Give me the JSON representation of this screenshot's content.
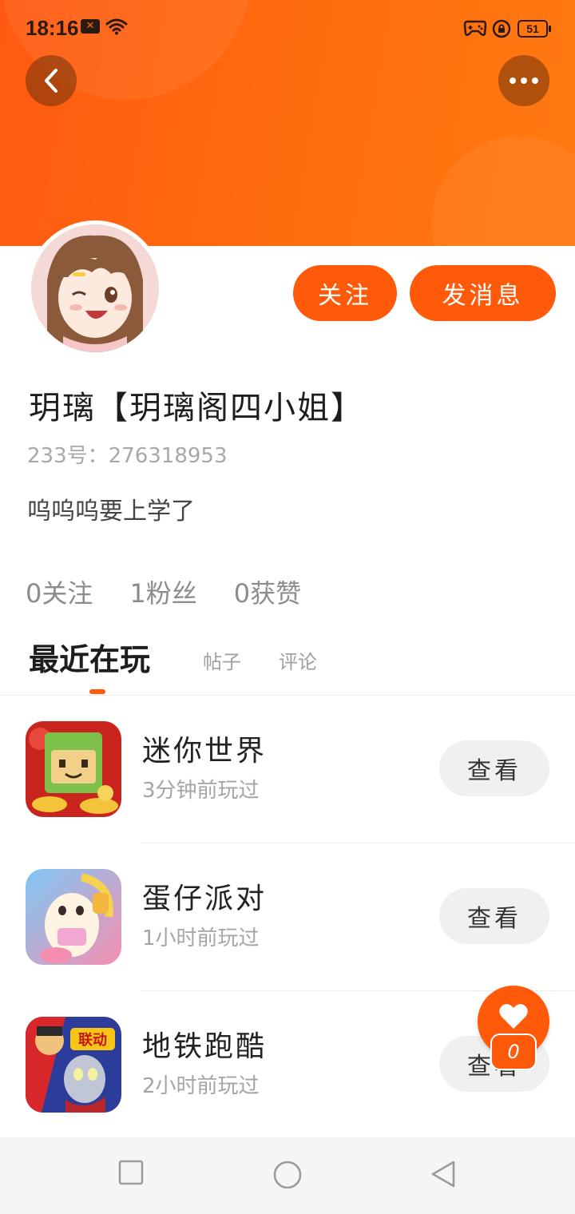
{
  "status_bar": {
    "time": "18:16",
    "battery": "51",
    "icons": [
      "mail-icon",
      "wifi-icon",
      "gamepad-icon",
      "lock-rotation-icon",
      "battery-icon"
    ]
  },
  "header": {
    "back_icon": "chevron-left-icon",
    "more_icon": "more-dots-icon",
    "gradient_colors": [
      "#ff5a12",
      "#ff7a10"
    ]
  },
  "profile": {
    "follow_label": "关注",
    "message_label": "发消息",
    "nickname": "玥璃【玥璃阁四小姐】",
    "uid": "233号：276318953",
    "bio": "呜呜呜要上学了",
    "stats": {
      "following": "0关注",
      "fans": "1粉丝",
      "likes": "0获赞"
    }
  },
  "tabs": [
    {
      "label": "最近在玩",
      "active": true
    },
    {
      "label": "帖子",
      "active": false
    },
    {
      "label": "评论",
      "active": false
    }
  ],
  "games": [
    {
      "name": "迷你世界",
      "played": "3分钟前玩过",
      "button": "查看"
    },
    {
      "name": "蛋仔派对",
      "played": "1小时前玩过",
      "button": "查看"
    },
    {
      "name": "地铁跑酷",
      "played": "2小时前玩过",
      "button": "查看"
    }
  ],
  "game3_badge": "联动",
  "like_fab": {
    "count": "0",
    "icon": "heart-icon"
  },
  "nav_bar": {
    "icons": [
      "recents-square-icon",
      "home-circle-icon",
      "back-triangle-icon"
    ]
  },
  "accent_color": "#ff5a0a"
}
